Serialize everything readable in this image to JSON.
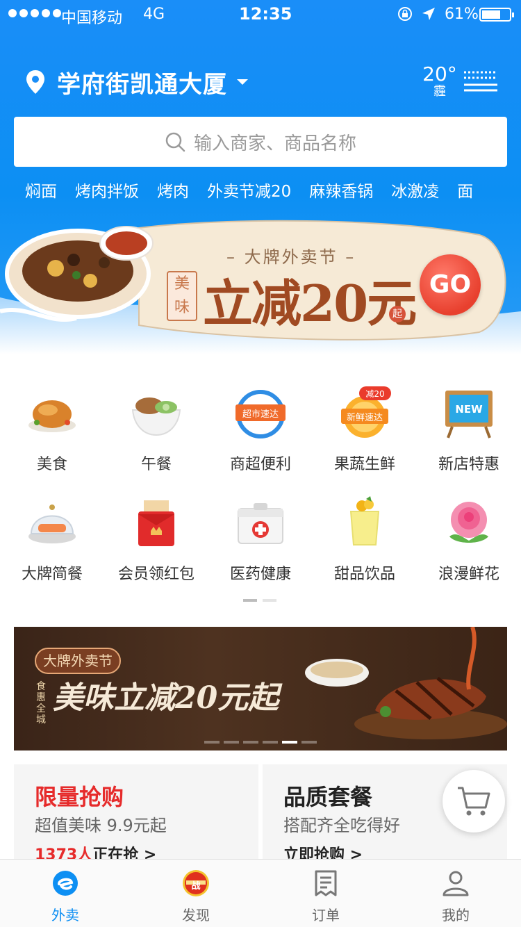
{
  "status_bar": {
    "carrier": "中国移动",
    "network": "4G",
    "time": "12:35",
    "battery": "61%"
  },
  "header": {
    "address": "学府街凯通大厦",
    "weather_temp": "20°",
    "weather_cond": "霾",
    "search_placeholder": "输入商家、商品名称",
    "hot_words": [
      "焖面",
      "烤肉拌饭",
      "烤肉",
      "外卖节减20",
      "麻辣香锅",
      "冰激凌",
      "面"
    ]
  },
  "promo": {
    "title": "– 大牌外卖节 –",
    "tag": "美味",
    "main": "立减20元",
    "suffix": "起",
    "go": "GO"
  },
  "categories": [
    {
      "label": "美食",
      "icon": "roast-chicken-icon"
    },
    {
      "label": "午餐",
      "icon": "lunch-bowl-icon"
    },
    {
      "label": "商超便利",
      "icon": "supermarket-icon",
      "badge": "超市速达"
    },
    {
      "label": "果蔬生鲜",
      "icon": "fresh-produce-icon",
      "badge": "新鲜速达",
      "tag": "减20"
    },
    {
      "label": "新店特惠",
      "icon": "new-shop-icon",
      "badge": "NEW"
    },
    {
      "label": "大牌简餐",
      "icon": "salmon-dish-icon"
    },
    {
      "label": "会员领红包",
      "icon": "red-envelope-icon"
    },
    {
      "label": "医药健康",
      "icon": "medicine-box-icon"
    },
    {
      "label": "甜品饮品",
      "icon": "dessert-drink-icon"
    },
    {
      "label": "浪漫鲜花",
      "icon": "rose-icon"
    }
  ],
  "ad_banner": {
    "tag": "大牌外卖节",
    "side": "食惠全城",
    "main": "美味立减20元起"
  },
  "features": [
    {
      "title": "限量抢购",
      "subtitle": "超值美味 9.9元起",
      "count": "1373人",
      "action": "正在抢 >"
    },
    {
      "title": "品质套餐",
      "subtitle": "搭配齐全吃得好",
      "action": "立即抢购 >"
    }
  ],
  "tabs": [
    {
      "label": "外卖",
      "icon": "takeout-icon",
      "active": true
    },
    {
      "label": "发现",
      "icon": "discover-icon"
    },
    {
      "label": "订单",
      "icon": "order-icon"
    },
    {
      "label": "我的",
      "icon": "profile-icon"
    }
  ],
  "colors": {
    "primary": "#0d8ff3",
    "flash_sale_red": "#e62b2b",
    "promo_brown": "#a04a22"
  }
}
